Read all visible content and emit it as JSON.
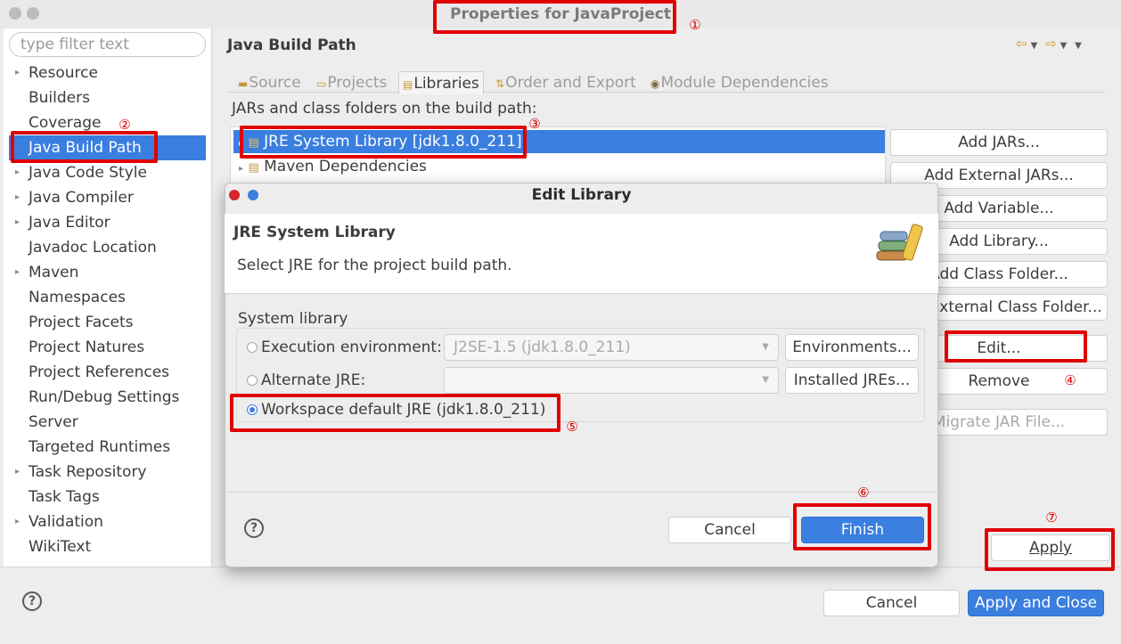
{
  "window": {
    "title": "Properties for JavaProject"
  },
  "filter": {
    "placeholder": "type filter text"
  },
  "tree": {
    "items": [
      {
        "label": "Resource",
        "expandable": true
      },
      {
        "label": "Builders",
        "expandable": false
      },
      {
        "label": "Coverage",
        "expandable": false
      },
      {
        "label": "Java Build Path",
        "expandable": false,
        "selected": true
      },
      {
        "label": "Java Code Style",
        "expandable": true
      },
      {
        "label": "Java Compiler",
        "expandable": true
      },
      {
        "label": "Java Editor",
        "expandable": true
      },
      {
        "label": "Javadoc Location",
        "expandable": false
      },
      {
        "label": "Maven",
        "expandable": true
      },
      {
        "label": "Namespaces",
        "expandable": false
      },
      {
        "label": "Project Facets",
        "expandable": false
      },
      {
        "label": "Project Natures",
        "expandable": false
      },
      {
        "label": "Project References",
        "expandable": false
      },
      {
        "label": "Run/Debug Settings",
        "expandable": false
      },
      {
        "label": "Server",
        "expandable": false
      },
      {
        "label": "Targeted Runtimes",
        "expandable": false
      },
      {
        "label": "Task Repository",
        "expandable": true
      },
      {
        "label": "Task Tags",
        "expandable": false
      },
      {
        "label": "Validation",
        "expandable": true
      },
      {
        "label": "WikiText",
        "expandable": false
      }
    ]
  },
  "page": {
    "title": "Java Build Path",
    "tabs": [
      "Source",
      "Projects",
      "Libraries",
      "Order and Export",
      "Module Dependencies"
    ],
    "active_tab": "Libraries",
    "list_label": "JARs and class folders on the build path:",
    "libraries": [
      "JRE System Library [jdk1.8.0_211]",
      "Maven Dependencies"
    ],
    "buttons": {
      "add_jars": "Add JARs...",
      "add_external_jars": "Add External JARs...",
      "add_variable": "Add Variable...",
      "add_library": "Add Library...",
      "add_class_folder": "Add Class Folder...",
      "add_external_class_folder": "Add External Class Folder...",
      "edit": "Edit...",
      "remove": "Remove",
      "migrate": "Migrate JAR File...",
      "apply": "Apply"
    }
  },
  "dialog": {
    "title": "Edit Library",
    "heading": "JRE System Library",
    "description": "Select JRE for the project build path.",
    "group_label": "System library",
    "options": {
      "exec_env": "Execution environment:",
      "exec_env_value": "J2SE-1.5 (jdk1.8.0_211)",
      "alt_jre": "Alternate JRE:",
      "alt_jre_value": "",
      "workspace": "Workspace default JRE (jdk1.8.0_211)"
    },
    "selected_option": "workspace",
    "environments_button": "Environments...",
    "installed_jres_button": "Installed JREs...",
    "cancel": "Cancel",
    "finish": "Finish"
  },
  "footer": {
    "cancel": "Cancel",
    "apply_close": "Apply and Close"
  },
  "annotations": [
    "①",
    "②",
    "③",
    "④",
    "⑤",
    "⑥",
    "⑦"
  ],
  "colors": {
    "accent": "#3a7ee0",
    "highlight_box": "#e00000",
    "close_dot": "#d62828",
    "min_dot": "#3a7ee0"
  }
}
